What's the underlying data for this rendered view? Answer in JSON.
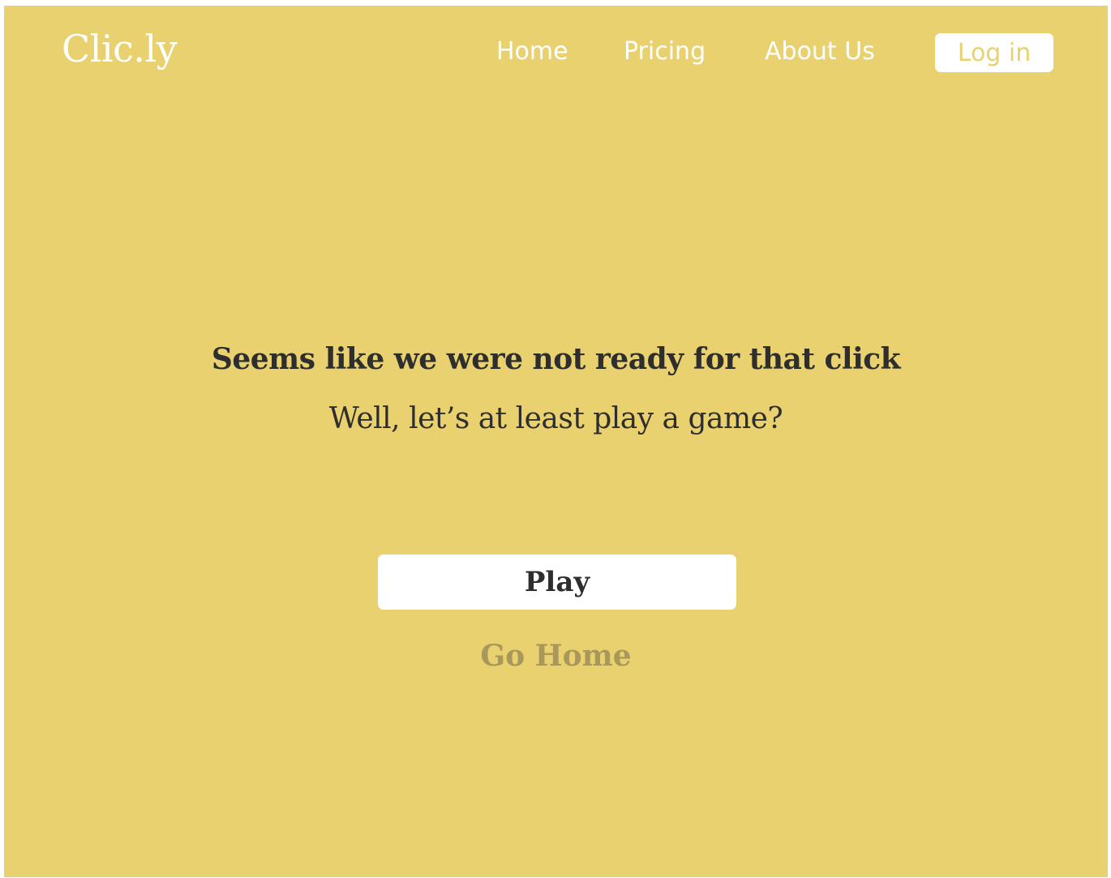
{
  "nav": {
    "brand": "Clic.ly",
    "links": [
      {
        "label": "Home"
      },
      {
        "label": "Pricing"
      },
      {
        "label": "About Us"
      }
    ],
    "login_label": "Log in"
  },
  "main": {
    "headline": "Seems like we were not ready for that click",
    "subline": "Well, let’s at least play a game?",
    "play_label": "Play",
    "go_home_label": "Go Home"
  },
  "colors": {
    "background": "#e9d16f",
    "text_dark": "#2e2e2e",
    "text_muted": "#a8985a",
    "white": "#ffffff"
  }
}
